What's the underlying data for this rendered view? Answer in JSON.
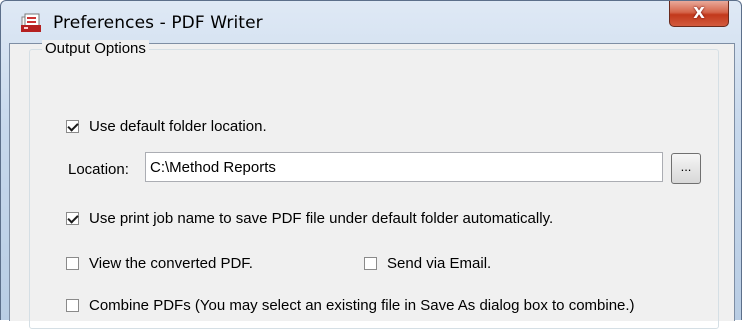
{
  "window": {
    "title": "Preferences - PDF Writer",
    "close_label": "X"
  },
  "output_options": {
    "legend": "Output Options",
    "use_default_folder": {
      "label": "Use default folder location.",
      "checked": true
    },
    "location": {
      "label": "Location:",
      "value": "C:\\Method Reports",
      "browse_label": "..."
    },
    "use_print_job_name": {
      "label": "Use print job name to save PDF file under default folder automatically.",
      "checked": true
    },
    "view_converted": {
      "label": "View the converted PDF.",
      "checked": false
    },
    "send_via_email": {
      "label": "Send via Email.",
      "checked": false
    },
    "combine_pdfs": {
      "label": "Combine PDFs (You may select an existing file in Save As dialog box to combine.)",
      "checked": false
    }
  },
  "colors": {
    "close_button": "#c2391c",
    "frame": "#c7d8ec",
    "client_bg": "#f0f0f0"
  }
}
